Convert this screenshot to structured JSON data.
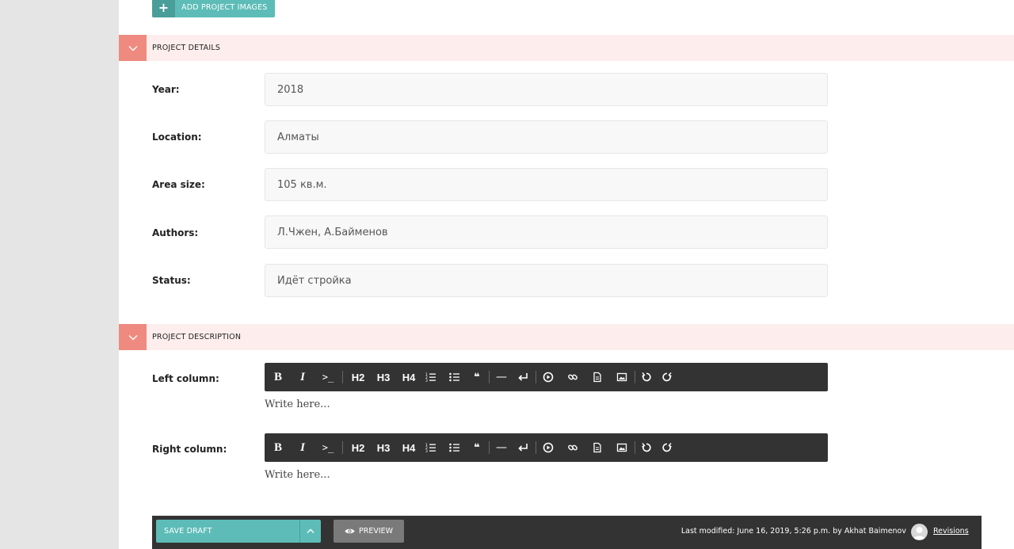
{
  "images": {
    "add_label": "ADD PROJECT IMAGES"
  },
  "details": {
    "title": "PROJECT DETAILS",
    "fields": [
      {
        "label": "Year:",
        "value": "2018"
      },
      {
        "label": "Location:",
        "value": "Алматы"
      },
      {
        "label": "Area size:",
        "value": "105 кв.м."
      },
      {
        "label": "Authors:",
        "value": "Л.Чжен, А.Байменов"
      },
      {
        "label": "Status:",
        "value": "Идёт стройка"
      }
    ]
  },
  "description": {
    "title": "PROJECT DESCRIPTION",
    "left_label": "Left column:",
    "right_label": "Right column:",
    "placeholder": "Write here..."
  },
  "toolbar": {
    "bold": "B",
    "italic": "I",
    "code": ">_",
    "h2": "H2",
    "h3": "H3",
    "h4": "H4",
    "quote": "❝",
    "hr": "—"
  },
  "footer": {
    "save_label": "SAVE DRAFT",
    "preview_label": "PREVIEW",
    "modified": "Last modified: June 16, 2019, 5:26 p.m. by Akhat Baimenov",
    "revisions": "Revisions"
  },
  "colors": {
    "accent": "#5dbcb7",
    "section_toggle": "#ef8a80",
    "section_bg": "#fdeeed",
    "toolbar_bg": "#333333"
  }
}
